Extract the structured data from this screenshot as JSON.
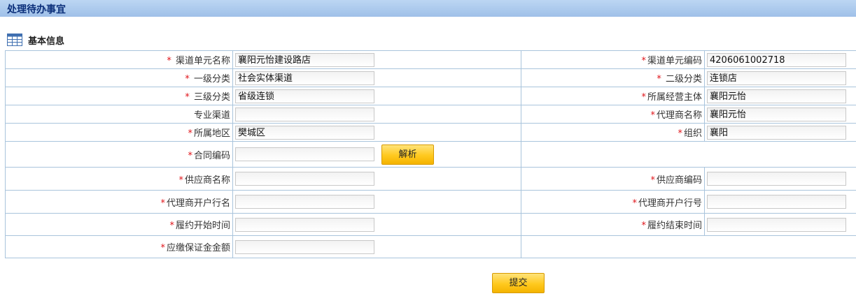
{
  "page": {
    "title": "处理待办事宜"
  },
  "section": {
    "title": "基本信息"
  },
  "fields": {
    "channel_unit_name": {
      "label": "渠道单元名称",
      "value": "襄阳元怡建设路店"
    },
    "channel_unit_code": {
      "label": "渠道单元编码",
      "value": "4206061002718"
    },
    "level1": {
      "label": "一级分类",
      "value": "社会实体渠道"
    },
    "level2": {
      "label": "二级分类",
      "value": "连锁店"
    },
    "level3": {
      "label": "三级分类",
      "value": "省级连锁"
    },
    "operating_entity": {
      "label": "所属经营主体",
      "value": "襄阳元怡"
    },
    "specialty_channel": {
      "label": "专业渠道",
      "value": ""
    },
    "agent_name": {
      "label": "代理商名称",
      "value": "襄阳元怡"
    },
    "region": {
      "label": "所属地区",
      "value": "樊城区"
    },
    "organization": {
      "label": "组织",
      "value": "襄阳"
    },
    "contract_code": {
      "label": "合同编码",
      "value": ""
    },
    "supplier_name": {
      "label": "供应商名称",
      "value": ""
    },
    "supplier_code": {
      "label": "供应商编码",
      "value": ""
    },
    "agent_bank_name": {
      "label": "代理商开户行名",
      "value": ""
    },
    "agent_bank_no": {
      "label": "代理商开户行号",
      "value": ""
    },
    "start_time": {
      "label": "履约开始时间",
      "value": ""
    },
    "end_time": {
      "label": "履约结束时间",
      "value": ""
    },
    "deposit_amount": {
      "label": "应缴保证金金额",
      "value": ""
    }
  },
  "buttons": {
    "parse": "解析",
    "submit": "提交"
  },
  "required_mark": "*",
  "icons": {
    "section": "table-icon"
  },
  "colors": {
    "header_bg": "#a9c8ec",
    "header_text": "#0b2f7a",
    "border": "#a9c4dc",
    "required": "#e0141a",
    "button": "#ffc91e"
  }
}
